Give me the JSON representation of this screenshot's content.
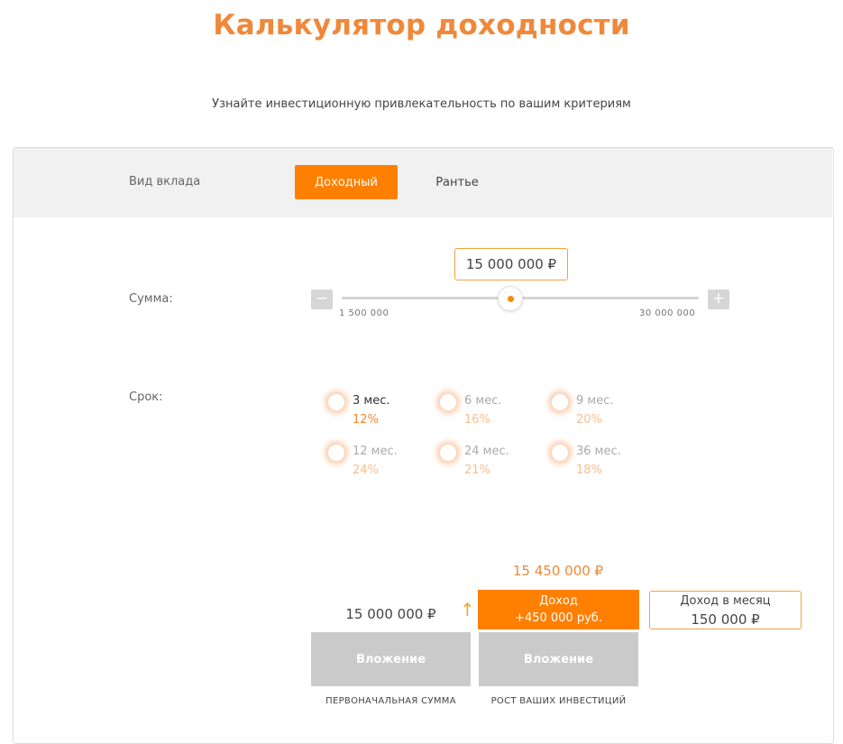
{
  "page": {
    "title": "Калькулятор доходности",
    "subtitle": "Узнайте инвестиционную привлекательность по вашим критериям"
  },
  "deposit_type": {
    "label": "Вид вклада",
    "options": [
      "Доходный",
      "Рантье"
    ],
    "selected": "Доходный"
  },
  "amount": {
    "label": "Сумма:",
    "value_display": "15 000 000 ₽",
    "min_label": "1 500 000",
    "max_label": "30 000 000",
    "minus": "−",
    "plus": "+",
    "slider_fraction": 0.47
  },
  "term": {
    "label": "Срок:",
    "options": [
      {
        "term": "3 мес.",
        "rate": "12%",
        "selected": true
      },
      {
        "term": "6 мес.",
        "rate": "16%",
        "selected": false
      },
      {
        "term": "9 мес.",
        "rate": "20%",
        "selected": false
      },
      {
        "term": "12 мес.",
        "rate": "24%",
        "selected": false
      },
      {
        "term": "24 мес.",
        "rate": "21%",
        "selected": false
      },
      {
        "term": "36 мес.",
        "rate": "18%",
        "selected": false
      }
    ]
  },
  "result": {
    "total": "15 450 000 ₽",
    "investment_value": "15 000 000 ₽",
    "arrow": "↑",
    "income_title": "Доход",
    "income_value": "+450 000 руб.",
    "monthly_title": "Доход в месяц",
    "monthly_value": "150 000 ₽",
    "bar_left_label": "Вложение",
    "bar_right_label": "Вложение",
    "caption_left": "ПЕРВОНАЧАЛЬНАЯ СУММА",
    "caption_right": "РОСТ ВАШИХ ИНВЕСТИЦИЙ"
  },
  "colors": {
    "accent": "#ff7f00",
    "title": "#f0883a",
    "bar_grey": "#cacaca"
  }
}
